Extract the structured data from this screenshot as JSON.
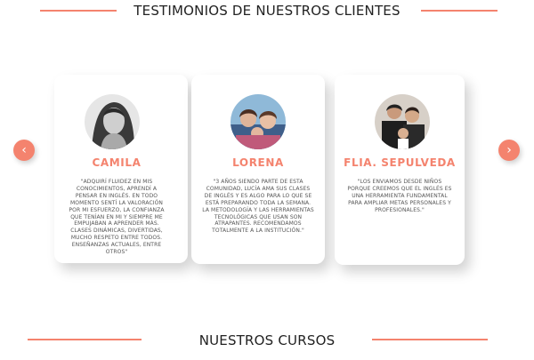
{
  "testimonials_section": {
    "title": "TESTIMONIOS DE NUESTROS CLIENTES",
    "prev_arrow": "‹",
    "next_arrow": "›",
    "cards": [
      {
        "name": "CAMILA",
        "quote": "\"Adquirí fluidez en mis conocimientos, aprendí a pensar en inglés. En todo momento sentí la valoración por mi esfuerzo, la confianza que tenían en mi y siempre me empujaban a aprender más. Clases dinámicas, divertidas, mucho respeto entre todos. Enseñanzas actuales, entre otros\""
      },
      {
        "name": "LORENA",
        "quote": "\"3 años siendo parte de esta comunidad, Lucía ama sus clases de inglés y es algo para lo que se está preparando toda la semana. La metodología y las herramientas tecnológicas que usan son atrapantes. Recomendamos totalmente a la institución.\""
      },
      {
        "name": "FLIA. SEPULVEDA",
        "quote": "\"Los enviamos desde niños porque creemos que el inglés es una herramienta fundamental para ampliar metas personales y profesionales.\""
      }
    ]
  },
  "courses_section": {
    "title": "NUESTROS CURSOS"
  },
  "colors": {
    "accent": "#f4836e",
    "text": "#333333"
  },
  "icons": {
    "prev": "chevron-left-icon",
    "next": "chevron-right-icon"
  }
}
